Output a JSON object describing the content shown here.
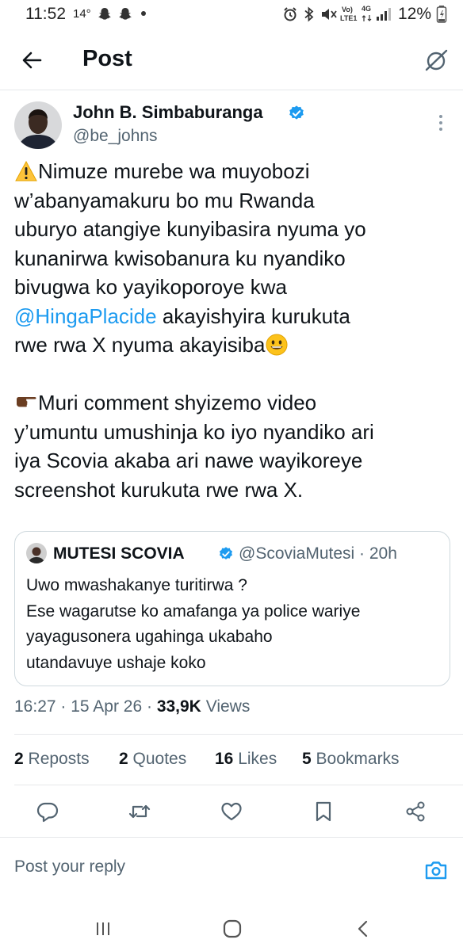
{
  "status_bar": {
    "time": "11:52",
    "temperature": "14°",
    "network_top": "Vo)",
    "network_bottom": "LTE1",
    "network_type": "4G",
    "battery": "12%",
    "icons": [
      "snapchat-icon",
      "snapchat-icon",
      "alarm-icon",
      "bluetooth-icon",
      "mute-icon",
      "signal-icon",
      "battery-icon"
    ]
  },
  "header": {
    "title": "Post",
    "back_icon": "arrow-left-icon",
    "grok_icon": "grok-icon"
  },
  "post": {
    "author_name": "John B. Simbaburanga",
    "author_handle": "@be_johns",
    "verified": true,
    "lines": [
      {
        "pre": "Nimuze murebe wa muyobozi",
        "emoji_before": "warning"
      },
      {
        "text": "w’abanyamakuru bo mu Rwanda"
      },
      {
        "text": "uburyo atangiye kunyibasira nyuma yo"
      },
      {
        "text": "kunanirwa kwisobanura ku nyandiko"
      },
      {
        "text": "bivugwa ko yayikoporoye kwa"
      },
      {
        "mention": "@HingaPlacide",
        "text": " akayishyira kurukuta"
      },
      {
        "text": "rwe  rwa X nyuma akayisiba",
        "emoji_after": "smile"
      },
      {
        "text": ""
      },
      {
        "pre": "Muri comment shyizemo video",
        "emoji_before": "point-right"
      },
      {
        "text": "y’umuntu umushinja ko iyo nyandiko ari"
      },
      {
        "text": "iya Scovia akaba ari nawe wayikoreye"
      },
      {
        "text": "screenshot kurukuta rwe rwa X."
      }
    ],
    "line_texts": {
      "l1": "Nimuze murebe wa muyobozi",
      "l2": "w’abanyamakuru bo mu Rwanda",
      "l3": "uburyo atangiye kunyibasira nyuma yo",
      "l4": "kunanirwa kwisobanura ku nyandiko",
      "l5": "bivugwa ko yayikoporoye kwa",
      "l6_mention": "@HingaPlacide",
      "l6_rest": " akayishyira kurukuta",
      "l7": "rwe  rwa X nyuma akayisiba",
      "l8": "Muri comment shyizemo video",
      "l9": "y’umuntu umushinja ko iyo nyandiko ari",
      "l10": "iya Scovia akaba ari nawe wayikoreye",
      "l11": "screenshot kurukuta rwe rwa X."
    },
    "time": "16:27",
    "date": "15 Apr 26",
    "views_count": "33,9K",
    "views_label": "Views"
  },
  "quote": {
    "author_name": "MUTESI SCOVIA",
    "author_handle": "@ScoviaMutesi · 20h",
    "verified": true,
    "lines": {
      "l1": "Uwo mwashakanye turitirwa ?",
      "l2": "Ese wagarutse ko amafanga ya police wariye",
      "l3": "yayagusonera ugahinga ukabaho",
      "l4": "utandavuye ushaje koko"
    }
  },
  "stats": {
    "reposts_count": "2",
    "reposts_label": "Reposts",
    "quotes_count": "2",
    "quotes_label": "Quotes",
    "likes_count": "16",
    "likes_label": "Likes",
    "bookmarks_count": "5",
    "bookmarks_label": "Bookmarks"
  },
  "actions": [
    "reply-icon",
    "repost-icon",
    "like-icon",
    "bookmark-icon",
    "share-icon"
  ],
  "reply": {
    "placeholder": "Post your reply",
    "camera_icon": "camera-icon"
  },
  "nav": [
    "recents-icon",
    "home-icon",
    "back-icon"
  ],
  "colors": {
    "accent": "#1d9bf0",
    "text_primary": "#0f1419",
    "text_secondary": "#536471",
    "border": "#cfd9de"
  }
}
